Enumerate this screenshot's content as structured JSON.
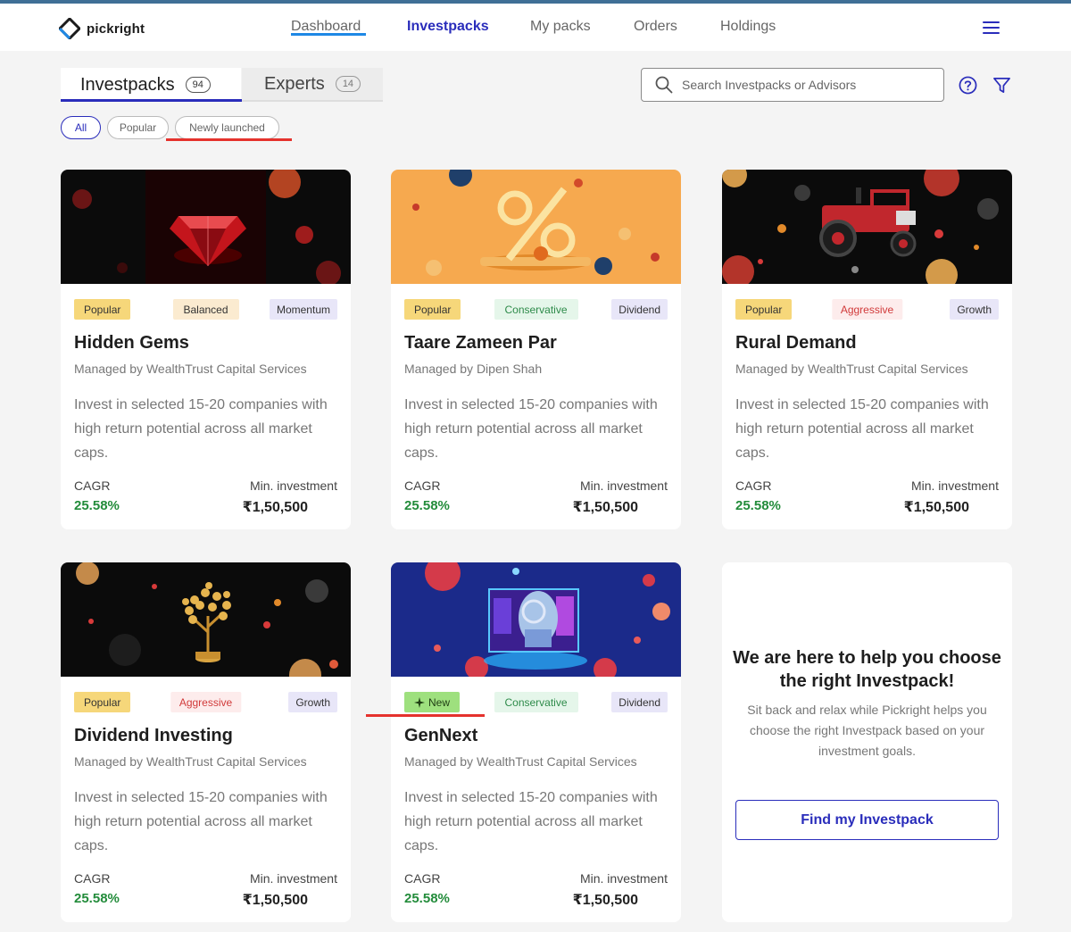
{
  "nav": {
    "logo_text": "pickright",
    "items": [
      "Dashboard",
      "Investpacks",
      "My packs",
      "Orders",
      "Holdings"
    ],
    "active": "Investpacks"
  },
  "tabs": {
    "investpacks": {
      "label": "Investpacks",
      "count": "94"
    },
    "experts": {
      "label": "Experts",
      "count": "14"
    }
  },
  "filters": [
    "All",
    "Popular",
    "Newly launched"
  ],
  "search": {
    "placeholder": "Search Investpacks or Advisors"
  },
  "cards": [
    {
      "image": "red-diamond",
      "tags": [
        "Popular",
        "Balanced",
        "Momentum"
      ],
      "title": "Hidden Gems",
      "manager": "Managed by WealthTrust Capital Services",
      "description": "Invest in selected 15-20 companies with high return potential across all market caps.",
      "cagr_label": "CAGR",
      "cagr": "25.58%",
      "min_label": "Min. investment",
      "min": "₹1,50,500"
    },
    {
      "image": "percent-sign-orange",
      "tags": [
        "Popular",
        "Conservative",
        "Dividend"
      ],
      "title": "Taare Zameen Par",
      "manager": "Managed by Dipen Shah",
      "description": "Invest in selected 15-20 companies with high return potential across all market caps.",
      "cagr_label": "CAGR",
      "cagr": "25.58%",
      "min_label": "Min. investment",
      "min": "₹1,50,500"
    },
    {
      "image": "red-tractor",
      "tags": [
        "Popular",
        "Aggressive",
        "Growth"
      ],
      "title": "Rural Demand",
      "manager": "Managed by WealthTrust Capital Services",
      "description": "Invest in selected 15-20 companies with high return potential across all market caps.",
      "cagr_label": "CAGR",
      "cagr": "25.58%",
      "min_label": "Min. investment",
      "min": "₹1,50,500"
    },
    {
      "image": "money-tree",
      "tags": [
        "Popular",
        "Aggressive",
        "Growth"
      ],
      "title": "Dividend Investing",
      "manager": "Managed by WealthTrust Capital Services",
      "description": "Invest in selected 15-20 companies with high return potential across all market caps.",
      "cagr_label": "CAGR",
      "cagr": "25.58%",
      "min_label": "Min. investment",
      "min": "₹1,50,500"
    },
    {
      "image": "robot-head",
      "tags": [
        "New",
        "Conservative",
        "Dividend"
      ],
      "title": "GenNext",
      "manager": "Managed by WealthTrust Capital Services",
      "description": "Invest in selected 15-20 companies with high return potential across all market caps.",
      "cagr_label": "CAGR",
      "cagr": "25.58%",
      "min_label": "Min. investment",
      "min": "₹1,50,500"
    }
  ],
  "help": {
    "title": "We are here to help you choose the right Investpack!",
    "text": "Sit back and relax while Pickright helps you choose the right Investpack based on your investment goals.",
    "button": "Find my Investpack"
  },
  "colors": {
    "accent": "#2a2dbb",
    "cagr_green": "#238c3b",
    "annotation_red": "#e5322d"
  }
}
